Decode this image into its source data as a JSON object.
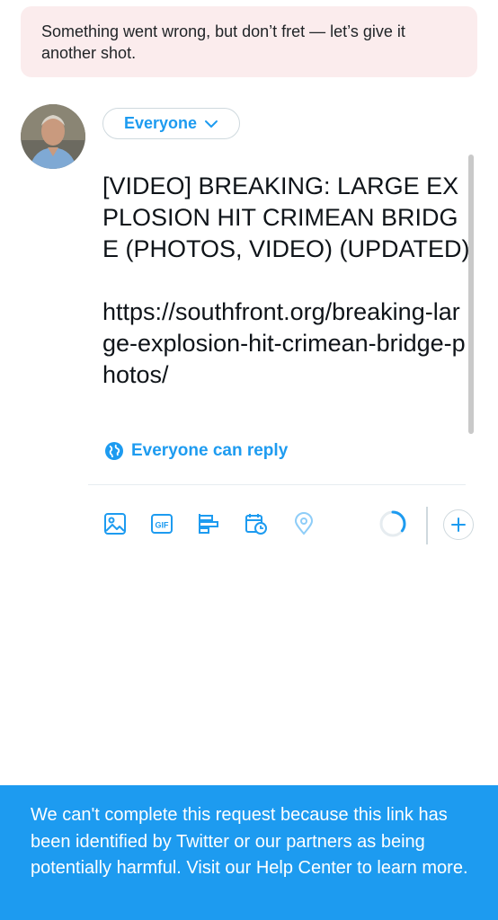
{
  "error_banner": {
    "text": "Something went wrong, but don’t fret — let’s give it another shot."
  },
  "composer": {
    "audience_label": "Everyone",
    "tweet_text": "[VIDEO] BREAKING: LARGE EXPLOSION HIT CRIMEAN BRIDGE (PHOTOS, VIDEO) (UPDATED)\n\nhttps://southfront.org/breaking-large-explosion-hit-crimean-bridge-photos/",
    "reply_setting_label": "Everyone can reply"
  },
  "toolbar": {
    "icons": [
      "image-icon",
      "gif-icon",
      "poll-icon",
      "schedule-icon",
      "location-icon"
    ],
    "gif_label": "GIF",
    "char_progress": 0.35
  },
  "toast": {
    "text": "We can't complete this request because this link has been identified by Twitter or our partners as being potentially harmful. Visit our Help Center to learn more."
  },
  "colors": {
    "accent": "#1d9bf0",
    "error_bg": "#fbeced",
    "border": "#cfd9de"
  }
}
